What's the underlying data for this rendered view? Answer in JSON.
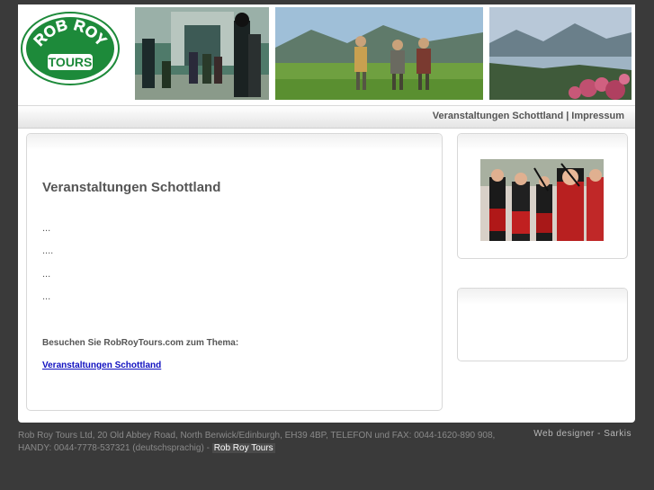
{
  "header": {
    "logo_top": "ROB ROY",
    "logo_bottom": "TOURS"
  },
  "nav": {
    "items": [
      {
        "label": "Veranstaltungen Schottland"
      },
      {
        "label": "Impressum"
      }
    ],
    "separator": "|"
  },
  "main": {
    "title": "Veranstaltungen Schottland",
    "dots": [
      "...",
      "....",
      "...",
      "..."
    ],
    "visit_text": "Besuchen Sie RobRoyTours.com zum Thema:",
    "visit_link": "Veranstaltungen Schottland"
  },
  "footer": {
    "address": "Rob Roy Tours Ltd, 20 Old Abbey Road, North Berwick/Edinburgh, EH39 4BP, TELEFON und FAX: 0044-1620-890 908, HANDY: 0044-7778-537321 (deutschsprachig) -",
    "link": "Rob Roy Tours",
    "designer": "Web designer - Sarkis"
  },
  "colors": {
    "background": "#3a3a3a",
    "logo_green": "#1d8a3a",
    "link_blue": "#1010c0",
    "text_gray": "#555555"
  }
}
